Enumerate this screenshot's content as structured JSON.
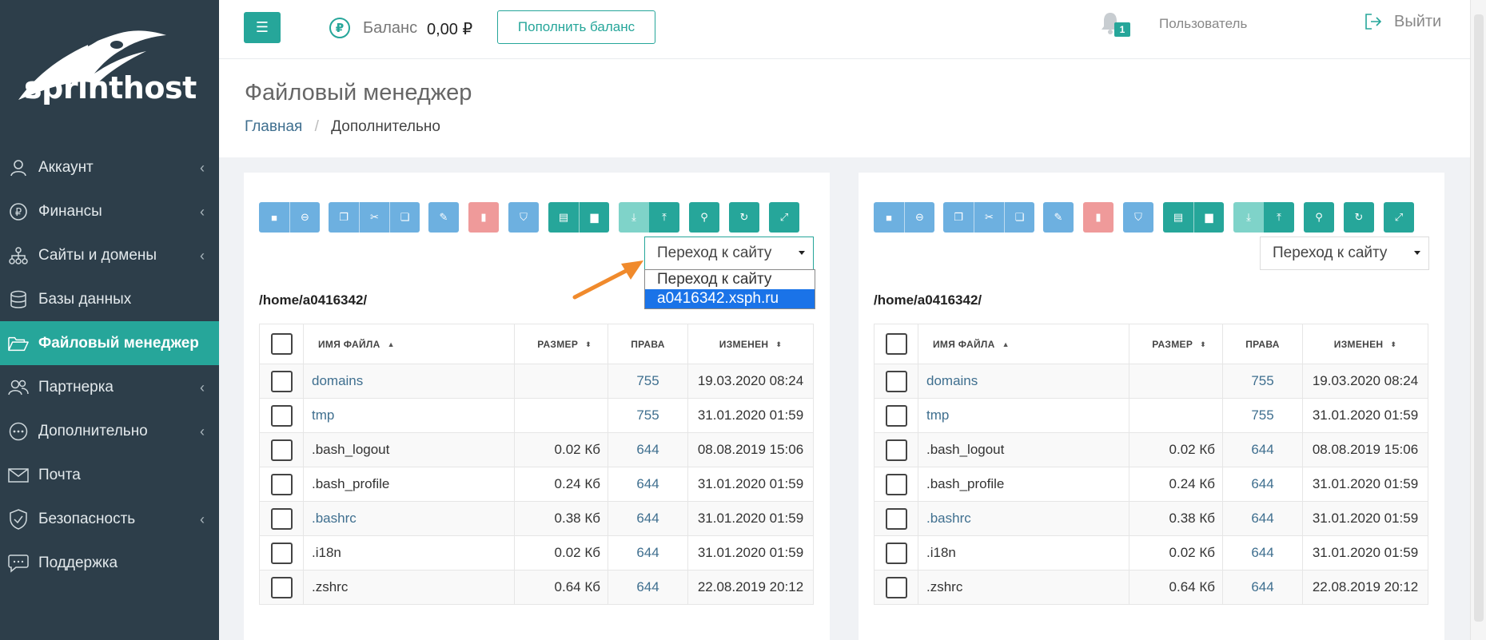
{
  "brand": {
    "name": "sprinthost"
  },
  "sidebar": {
    "items": [
      {
        "label": "Аккаунт",
        "icon": "user-icon",
        "chevron": true,
        "active": false
      },
      {
        "label": "Финансы",
        "icon": "ruble-icon",
        "chevron": true,
        "active": false
      },
      {
        "label": "Сайты и домены",
        "icon": "sitemap-icon",
        "chevron": true,
        "active": false
      },
      {
        "label": "Базы данных",
        "icon": "database-icon",
        "chevron": false,
        "active": false
      },
      {
        "label": "Файловый менеджер",
        "icon": "folder-open-icon",
        "chevron": false,
        "active": true
      },
      {
        "label": "Партнерка",
        "icon": "users-icon",
        "chevron": true,
        "active": false
      },
      {
        "label": "Дополнительно",
        "icon": "more-icon",
        "chevron": true,
        "active": false
      },
      {
        "label": "Почта",
        "icon": "envelope-icon",
        "chevron": false,
        "active": false
      },
      {
        "label": "Безопасность",
        "icon": "shield-icon",
        "chevron": true,
        "active": false
      },
      {
        "label": "Поддержка",
        "icon": "chat-icon",
        "chevron": false,
        "active": false
      }
    ]
  },
  "topbar": {
    "balance_label": "Баланс",
    "balance_value": "0,00 ₽",
    "topup_label": "Пополнить баланс",
    "notifications_count": "1",
    "user_label": "Пользователь",
    "logout_label": "Выйти",
    "ruble_symbol": "₽"
  },
  "header": {
    "title": "Файловый менеджер",
    "breadcrumb_home": "Главная",
    "breadcrumb_separator": "/",
    "breadcrumb_current": "Дополнительно"
  },
  "site_select": {
    "placeholder": "Переход к сайту",
    "options": [
      "Переход к сайту",
      "a0416342.xsph.ru"
    ],
    "highlighted": "a0416342.xsph.ru"
  },
  "toolbar_buttons": [
    {
      "icon": "square-icon",
      "color": "blue"
    },
    {
      "icon": "drive-icon",
      "color": "blue"
    },
    {
      "icon": "copy-icon",
      "color": "blue"
    },
    {
      "icon": "scissors-icon",
      "color": "blue"
    },
    {
      "icon": "paste-icon",
      "color": "blue"
    },
    {
      "icon": "pencil-icon",
      "color": "blue"
    },
    {
      "icon": "trash-icon",
      "color": "red"
    },
    {
      "icon": "shield-icon",
      "color": "blue"
    },
    {
      "icon": "new-file-icon",
      "color": "green"
    },
    {
      "icon": "new-folder-icon",
      "color": "green"
    },
    {
      "icon": "download-icon",
      "color": "lightgreen"
    },
    {
      "icon": "upload-icon",
      "color": "green"
    },
    {
      "icon": "search-icon",
      "color": "green"
    },
    {
      "icon": "refresh-icon",
      "color": "green"
    },
    {
      "icon": "fullscreen-icon",
      "color": "green"
    }
  ],
  "file_table": {
    "path": "/home/a0416342/",
    "columns": [
      "Имя файла",
      "Размер",
      "Права",
      "Изменен"
    ],
    "rows": [
      {
        "name": "domains",
        "size": "",
        "perm": "755",
        "date": "19.03.2020 08:24",
        "link": true
      },
      {
        "name": "tmp",
        "size": "",
        "perm": "755",
        "date": "31.01.2020 01:59",
        "link": true
      },
      {
        "name": ".bash_logout",
        "size": "0.02 Кб",
        "perm": "644",
        "date": "08.08.2019 15:06",
        "link": false
      },
      {
        "name": ".bash_profile",
        "size": "0.24 Кб",
        "perm": "644",
        "date": "31.01.2020 01:59",
        "link": false
      },
      {
        "name": ".bashrc",
        "size": "0.38 Кб",
        "perm": "644",
        "date": "31.01.2020 01:59",
        "link": true
      },
      {
        "name": ".i18n",
        "size": "0.02 Кб",
        "perm": "644",
        "date": "31.01.2020 01:59",
        "link": false
      },
      {
        "name": ".zshrc",
        "size": "0.64 Кб",
        "perm": "644",
        "date": "22.08.2019 20:12",
        "link": false
      }
    ]
  },
  "colors": {
    "accent": "#26a69a",
    "sidebar_bg": "#2d3e4a",
    "button_blue": "#6db0e0",
    "button_red": "#ef9a9a",
    "link": "#3f6f8f",
    "annotation_arrow": "#f08a2c"
  }
}
